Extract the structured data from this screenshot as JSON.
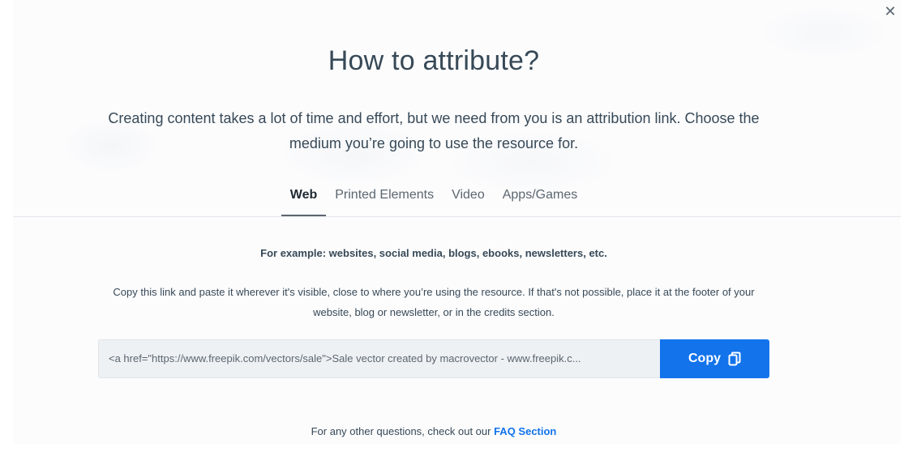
{
  "modal": {
    "close_symbol": "✕",
    "title": "How to attribute?",
    "subtitle": "Creating content takes a lot of time and effort, but we need from you is an attribution link. Choose the medium you’re going to use the resource for."
  },
  "tabs": [
    {
      "label": "Web",
      "active": true
    },
    {
      "label": "Printed Elements",
      "active": false
    },
    {
      "label": "Video",
      "active": false
    },
    {
      "label": "Apps/Games",
      "active": false
    }
  ],
  "web_panel": {
    "example": "For example: websites, social media, blogs, ebooks, newsletters, etc.",
    "instructions": "Copy this link and paste it wherever it's visible, close to where you’re using the resource. If that's not possible, place it at the footer of your website, blog or newsletter, or in the credits section.",
    "attribution_value": "<a href=\"https://www.freepik.com/vectors/sale\">Sale vector created by macrovector - www.freepik.c...",
    "copy_label": "Copy",
    "copy_icon": "copy-icon"
  },
  "footer": {
    "text": "For any other questions, check out our ",
    "link_label": "FAQ Section"
  },
  "colors": {
    "accent": "#1273eb",
    "text": "#374957",
    "field_bg": "#eef1f4"
  }
}
